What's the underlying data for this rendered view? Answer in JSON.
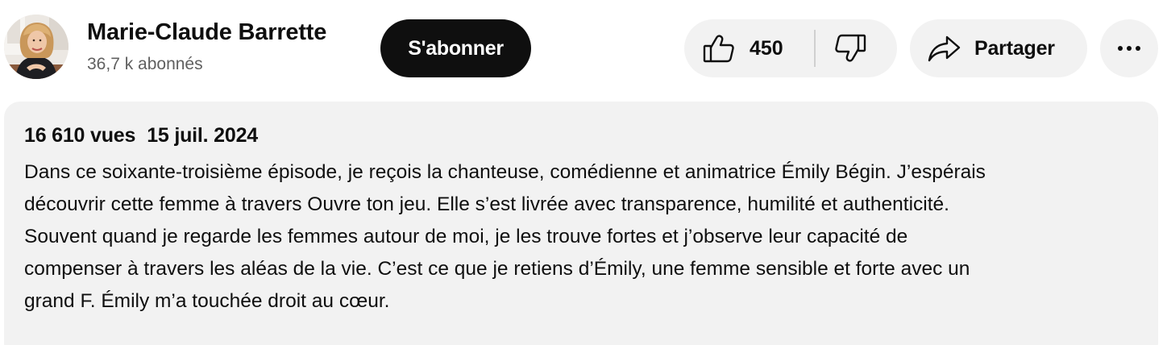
{
  "channel": {
    "name": "Marie-Claude Barrette",
    "subscribers": "36,7 k abonnés",
    "avatar_icon": "channel-avatar-portrait"
  },
  "actions": {
    "subscribe_label": "S'abonner",
    "like_icon": "thumbs-up-icon",
    "like_count": "450",
    "dislike_icon": "thumbs-down-icon",
    "share_icon": "share-arrow-icon",
    "share_label": "Partager",
    "more_icon": "more-horizontal-icon"
  },
  "description": {
    "views": "16 610 vues",
    "date": "15 juil. 2024",
    "lines": [
      "Dans ce soixante-troisième épisode, je reçois la chanteuse, comédienne et animatrice Émily Bégin. J’espérais",
      "découvrir cette femme à travers Ouvre ton jeu. Elle s’est livrée avec transparence, humilité et authenticité.",
      "Souvent quand je regarde les femmes autour de moi, je les trouve fortes et j’observe leur capacité de",
      "compenser à travers les aléas de la vie. C’est ce que je retiens d’Émily, une femme sensible et forte avec un",
      "grand F. Émily m’a touchée droit au cœur."
    ]
  },
  "colors": {
    "primary_text": "#0f0f0f",
    "secondary_text": "#606060",
    "pill_background": "#f2f2f2",
    "subscribe_background": "#0f0f0f",
    "subscribe_text": "#ffffff"
  }
}
